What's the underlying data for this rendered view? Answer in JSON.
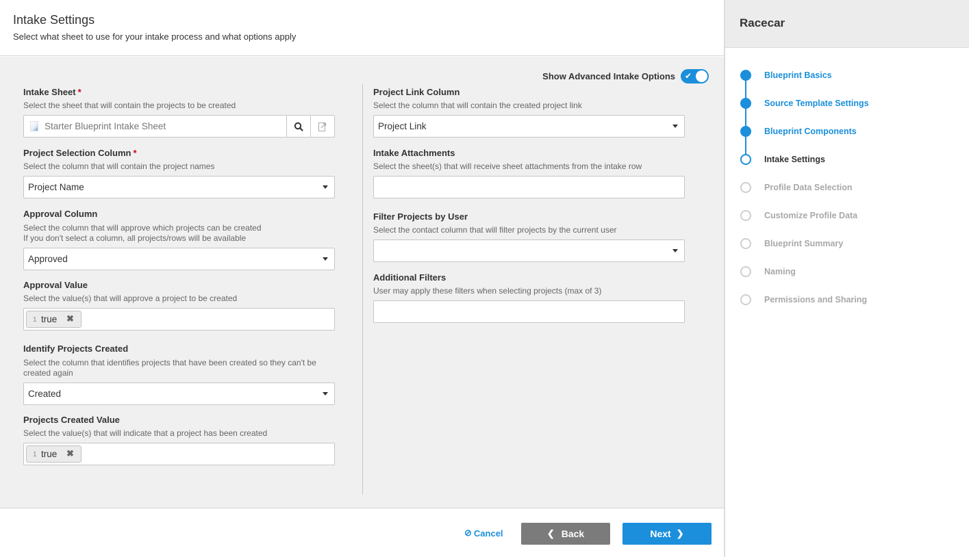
{
  "header": {
    "title": "Intake Settings",
    "subtitle": "Select what sheet to use for your intake process and what options apply"
  },
  "advanced_toggle": {
    "label": "Show Advanced Intake Options",
    "on": true
  },
  "left_fields": {
    "intake_sheet": {
      "label": "Intake Sheet",
      "required_mark": "*",
      "desc": "Select the sheet that will contain the projects to be created",
      "value": "Starter Blueprint Intake Sheet"
    },
    "project_selection": {
      "label": "Project Selection Column",
      "required_mark": "*",
      "desc": "Select the column that will contain the project names",
      "value": "Project Name"
    },
    "approval_column": {
      "label": "Approval Column",
      "desc": "Select the column that will approve which projects can be created",
      "desc2": "If you don't select a column, all projects/rows will be available",
      "value": "Approved"
    },
    "approval_value": {
      "label": "Approval Value",
      "desc": "Select the value(s) that will approve a project to be created",
      "tags": [
        {
          "index": "1",
          "value": "true",
          "remove": "✖"
        }
      ]
    },
    "identify_created": {
      "label": "Identify Projects Created",
      "desc": "Select the column that identifies projects that have been created so they can't be created again",
      "value": "Created"
    },
    "created_value": {
      "label": "Projects Created Value",
      "desc": "Select the value(s) that will indicate that a project has been created",
      "tags": [
        {
          "index": "1",
          "value": "true",
          "remove": "✖"
        }
      ]
    }
  },
  "right_fields": {
    "project_link": {
      "label": "Project Link Column",
      "desc": "Select the column that will contain the created project link",
      "value": "Project Link"
    },
    "intake_attachments": {
      "label": "Intake Attachments",
      "desc": "Select the sheet(s) that will receive sheet attachments from the intake row",
      "value": ""
    },
    "filter_by_user": {
      "label": "Filter Projects by User",
      "desc": "Select the contact column that will filter projects by the current user",
      "value": ""
    },
    "additional_filters": {
      "label": "Additional Filters",
      "desc": "User may apply these filters when selecting projects (max of 3)",
      "value": ""
    }
  },
  "footer": {
    "cancel": "Cancel",
    "back": "Back",
    "next": "Next"
  },
  "sidebar": {
    "name": "Racecar",
    "steps": [
      {
        "label": "Blueprint Basics",
        "state": "done"
      },
      {
        "label": "Source Template Settings",
        "state": "done"
      },
      {
        "label": "Blueprint Components",
        "state": "done"
      },
      {
        "label": "Intake Settings",
        "state": "current"
      },
      {
        "label": "Profile Data Selection",
        "state": "todo"
      },
      {
        "label": "Customize Profile Data",
        "state": "todo"
      },
      {
        "label": "Blueprint Summary",
        "state": "todo"
      },
      {
        "label": "Naming",
        "state": "todo"
      },
      {
        "label": "Permissions and Sharing",
        "state": "todo"
      }
    ]
  },
  "colors": {
    "accent": "#1b8fdb",
    "back_button": "#7b7b7b",
    "required": "#d0021b"
  }
}
